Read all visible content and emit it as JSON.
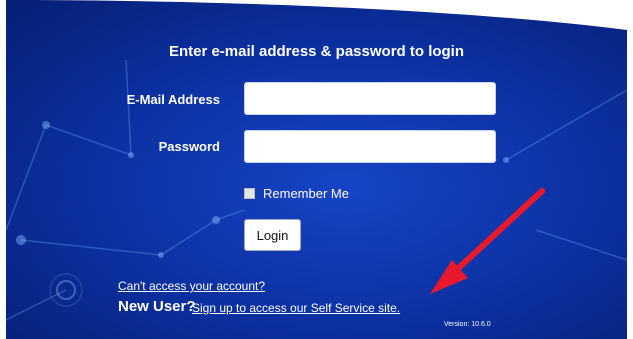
{
  "login": {
    "heading": "Enter e-mail address & password to login",
    "email_label": "E-Mail Address",
    "email_value": "",
    "password_label": "Password",
    "password_value": "",
    "remember_label": "Remember Me",
    "remember_checked": false,
    "login_button": "Login"
  },
  "footer": {
    "cant_access": "Can't access your account?",
    "new_user": "New User?",
    "signup_link": "Sign up to access our Self Service site.",
    "version": "Version: 10.6.0"
  },
  "colors": {
    "background_blue": "#0b2f9e",
    "arrow_red": "#e8192c",
    "text": "#ffffff"
  },
  "annotation": {
    "arrow": "red-arrow-icon"
  }
}
